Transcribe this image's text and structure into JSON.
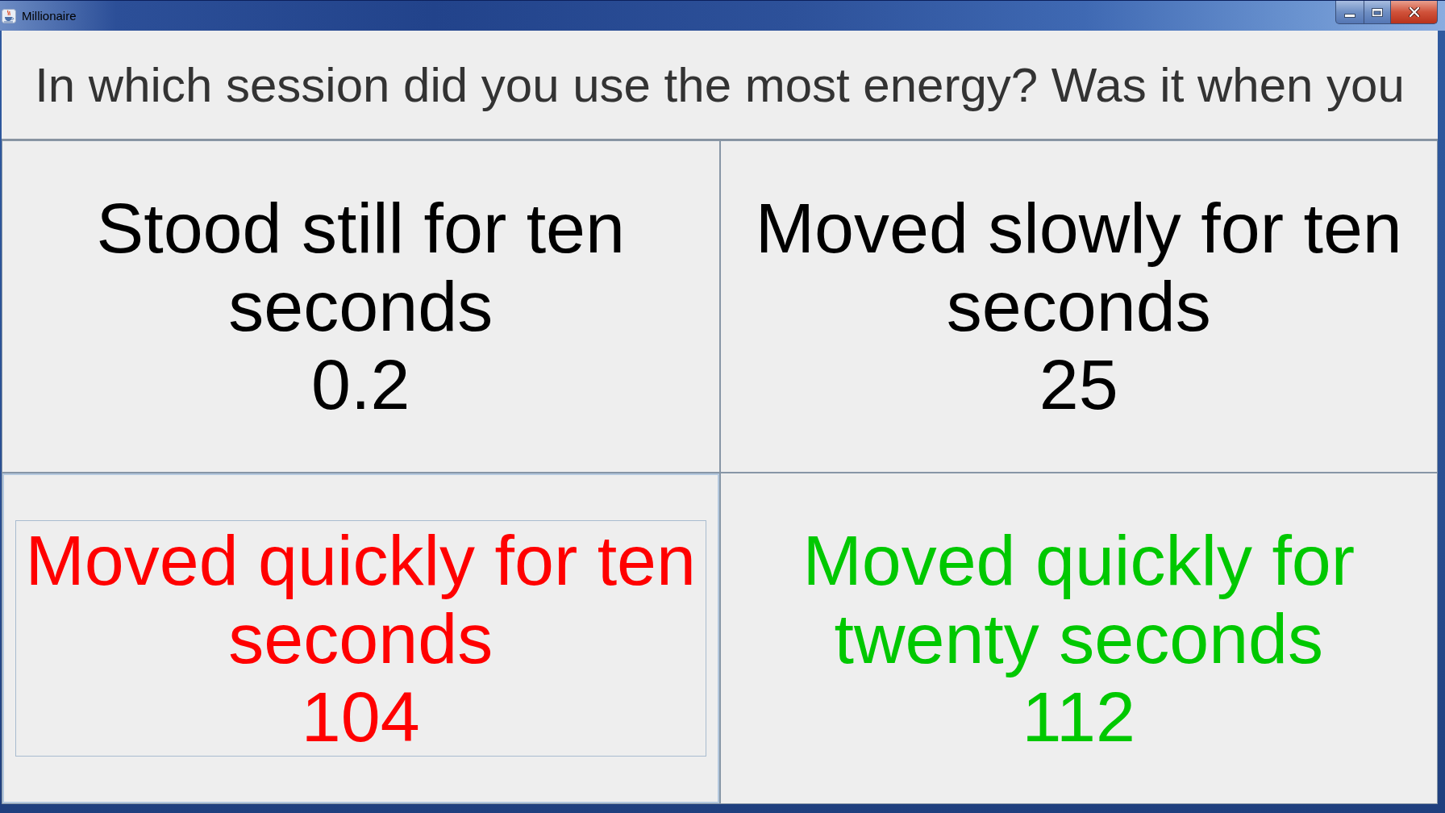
{
  "window": {
    "title": "Millionaire"
  },
  "question": {
    "text": "In which session did you use the most energy? Was it when you"
  },
  "answers": [
    {
      "text": "Stood still for ten seconds",
      "value": "0.2",
      "color": "#000000",
      "selected": false
    },
    {
      "text": "Moved slowly for ten seconds",
      "value": "25",
      "color": "#000000",
      "selected": false
    },
    {
      "text": "Moved quickly for ten seconds",
      "value": "104",
      "color": "#ff0000",
      "selected": true
    },
    {
      "text": "Moved quickly for twenty seconds",
      "value": "112",
      "color": "#00c800",
      "selected": false
    }
  ]
}
